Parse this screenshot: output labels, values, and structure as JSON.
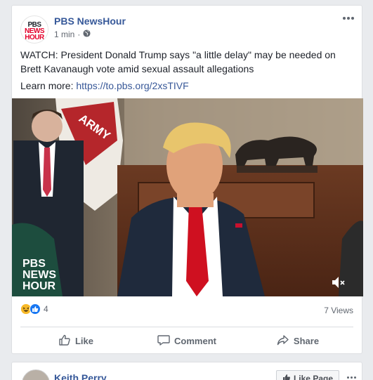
{
  "post": {
    "author": "PBS NewsHour",
    "logo_lines": [
      "PBS",
      "NEWS",
      "HOUR"
    ],
    "time": "1 min",
    "separator": "·",
    "text": "WATCH: President Donald Trump says \"a little delay\" may be needed on Brett Kavanaugh vote amid sexual assault allegations",
    "learn_label": "Learn more:",
    "learn_link": "https://to.pbs.org/2xsTIVF",
    "video": {
      "watermark": [
        "PBS",
        "NEWS",
        "HOUR"
      ],
      "flag_text": "ARMY",
      "volume_muted": true
    },
    "reactions": {
      "types": [
        "haha",
        "like"
      ],
      "count": "4"
    },
    "views": "7 Views",
    "actions": {
      "like": "Like",
      "comment": "Comment",
      "share": "Share"
    },
    "colors": {
      "author": "#365899",
      "link": "#385898",
      "like_blue": "#1877f2",
      "haha_yellow": "#f7b928"
    }
  },
  "next_post": {
    "author": "Keith Perry",
    "like_page_label": "Like Page"
  }
}
